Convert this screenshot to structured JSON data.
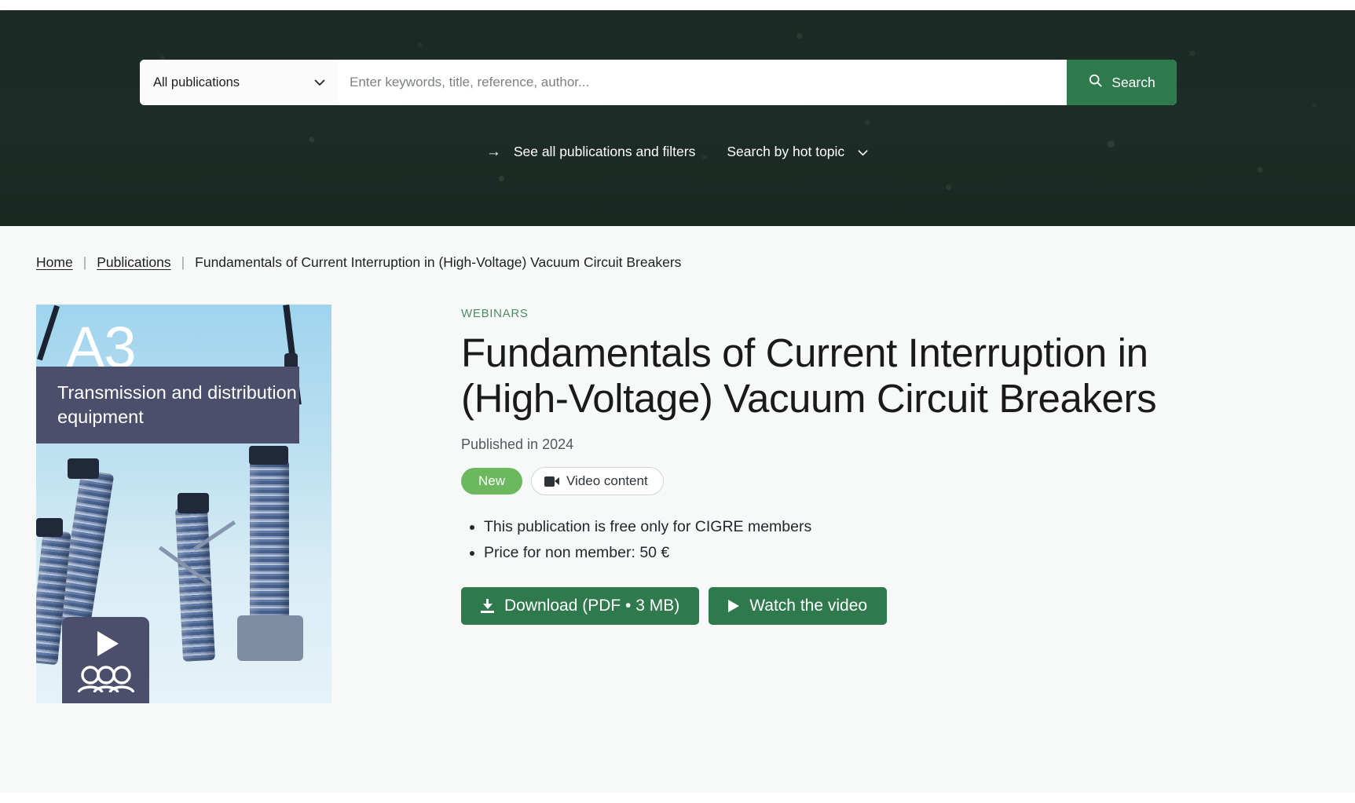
{
  "search": {
    "scope_label": "All publications",
    "scope_icon": "chevron-down-icon",
    "placeholder": "Enter keywords, title, reference, author...",
    "value": "",
    "button_label": "Search",
    "button_icon": "search-icon",
    "button_color": "#2f7a4c"
  },
  "hero_links": {
    "all_publications": {
      "arrow": "→",
      "label": "See all publications and filters"
    },
    "hot_topic": {
      "label": "Search by hot topic",
      "icon": "chevron-down-icon"
    }
  },
  "breadcrumb": {
    "home": "Home",
    "separator": "|",
    "publications": "Publications",
    "current": "Fundamentals of Current Interruption in (High-Voltage) Vacuum Circuit Breakers"
  },
  "cover": {
    "study_committee_code": "A3",
    "study_committee_name": "Transmission and distribution equipment",
    "play_icon": "play-icon",
    "audience_icon": "people-group-icon",
    "banner_color": "#4b4f6b"
  },
  "publication": {
    "kicker": "WEBINARS",
    "kicker_color": "#4c8c63",
    "title": "Fundamentals of Current Interruption in (High-Voltage) Vacuum Circuit Breakers",
    "published": "Published in 2024",
    "tags": {
      "new": "New",
      "new_color": "#6cb85f",
      "video": "Video content",
      "video_icon": "video-camera-icon"
    },
    "info": [
      "This publication is free only for CIGRE members",
      "Price for non member: 50 €"
    ],
    "actions": {
      "download": {
        "label": "Download (PDF • 3 MB)",
        "icon": "download-icon"
      },
      "watch": {
        "label": "Watch the video",
        "icon": "play-icon"
      }
    }
  }
}
